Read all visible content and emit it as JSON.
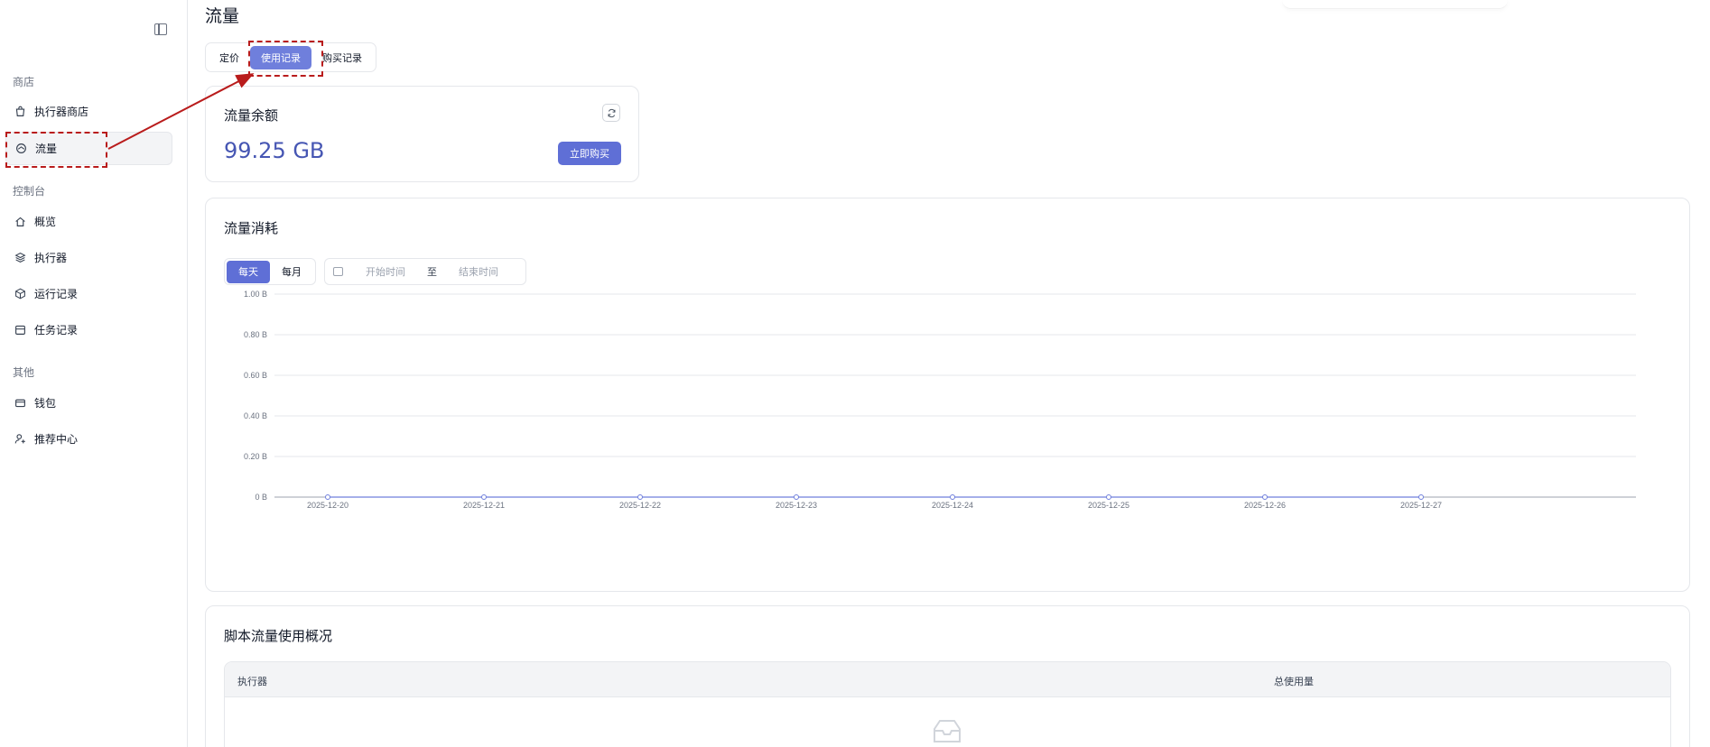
{
  "sidebar": {
    "groups": {
      "shop": "商店",
      "console": "控制台",
      "other": "其他"
    },
    "items": [
      {
        "label": "执行器商店",
        "icon": "shopping-bag-icon"
      },
      {
        "label": "流量",
        "icon": "traffic-icon",
        "active": true
      },
      {
        "label": "概览",
        "icon": "home-icon"
      },
      {
        "label": "执行器",
        "icon": "layers-icon"
      },
      {
        "label": "运行记录",
        "icon": "box-icon"
      },
      {
        "label": "任务记录",
        "icon": "calendar-icon"
      },
      {
        "label": "钱包",
        "icon": "wallet-icon"
      },
      {
        "label": "推荐中心",
        "icon": "user-plus-icon"
      }
    ]
  },
  "header": {
    "title": "流量",
    "tabs": [
      {
        "label": "定价"
      },
      {
        "label": "使用记录",
        "active": true
      },
      {
        "label": "购买记录"
      }
    ]
  },
  "balance": {
    "title": "流量余额",
    "value": "99.25 GB",
    "buy_label": "立即购买"
  },
  "consumption": {
    "title": "流量消耗",
    "range_options": [
      "每天",
      "每月"
    ],
    "date_range": {
      "start_placeholder": "开始时间",
      "separator": "至",
      "end_placeholder": "结束时间"
    }
  },
  "chart_data": {
    "type": "line",
    "x": [
      "2025-12-20",
      "2025-12-21",
      "2025-12-22",
      "2025-12-23",
      "2025-12-24",
      "2025-12-25",
      "2025-12-26",
      "2025-12-27"
    ],
    "series": [
      {
        "values": [
          0,
          0,
          0,
          0,
          0,
          0,
          0,
          0
        ]
      }
    ],
    "yticks": [
      "0 B",
      "0.20 B",
      "0.40 B",
      "0.60 B",
      "0.80 B",
      "1.00 B"
    ],
    "ylim": [
      0,
      1
    ],
    "grid": true,
    "colors": {
      "line": "#6f7fdc",
      "grid": "#e5e7eb",
      "axis": "#9ca3af"
    }
  },
  "script_usage": {
    "title": "脚本流量使用概况",
    "columns": [
      "执行器",
      "总使用量"
    ]
  },
  "colors": {
    "accent": "#5f6fd6",
    "annotation": "#b91c1c"
  }
}
